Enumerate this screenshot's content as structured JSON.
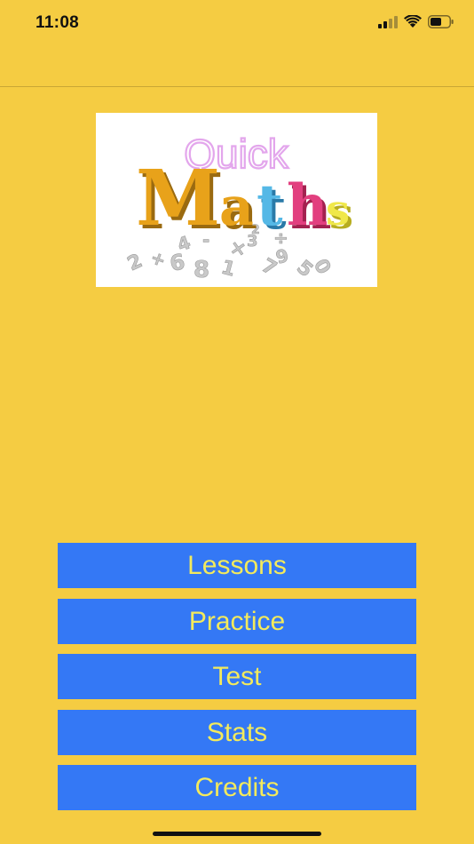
{
  "status_bar": {
    "time": "11:08",
    "icons": [
      "cellular-signal-icon",
      "wifi-icon",
      "battery-icon"
    ]
  },
  "logo": {
    "line1": "Quick",
    "line2_letters": [
      "M",
      "a",
      "t",
      "h",
      "s"
    ],
    "line2_colors": [
      "#e8a21a",
      "#e8a21a",
      "#55b8e6",
      "#e23f7f",
      "#f0e84a"
    ],
    "line1_color": "#e3a6ec",
    "symbols": "÷ + - × 9 8 6 4 2 3 1 5 7"
  },
  "menu": {
    "items": [
      {
        "label": "Lessons"
      },
      {
        "label": "Practice"
      },
      {
        "label": "Test"
      },
      {
        "label": "Stats"
      },
      {
        "label": "Credits"
      }
    ]
  },
  "colors": {
    "background": "#f5cc42",
    "button_bg": "#3478f5",
    "button_text": "#f3ea5c"
  }
}
